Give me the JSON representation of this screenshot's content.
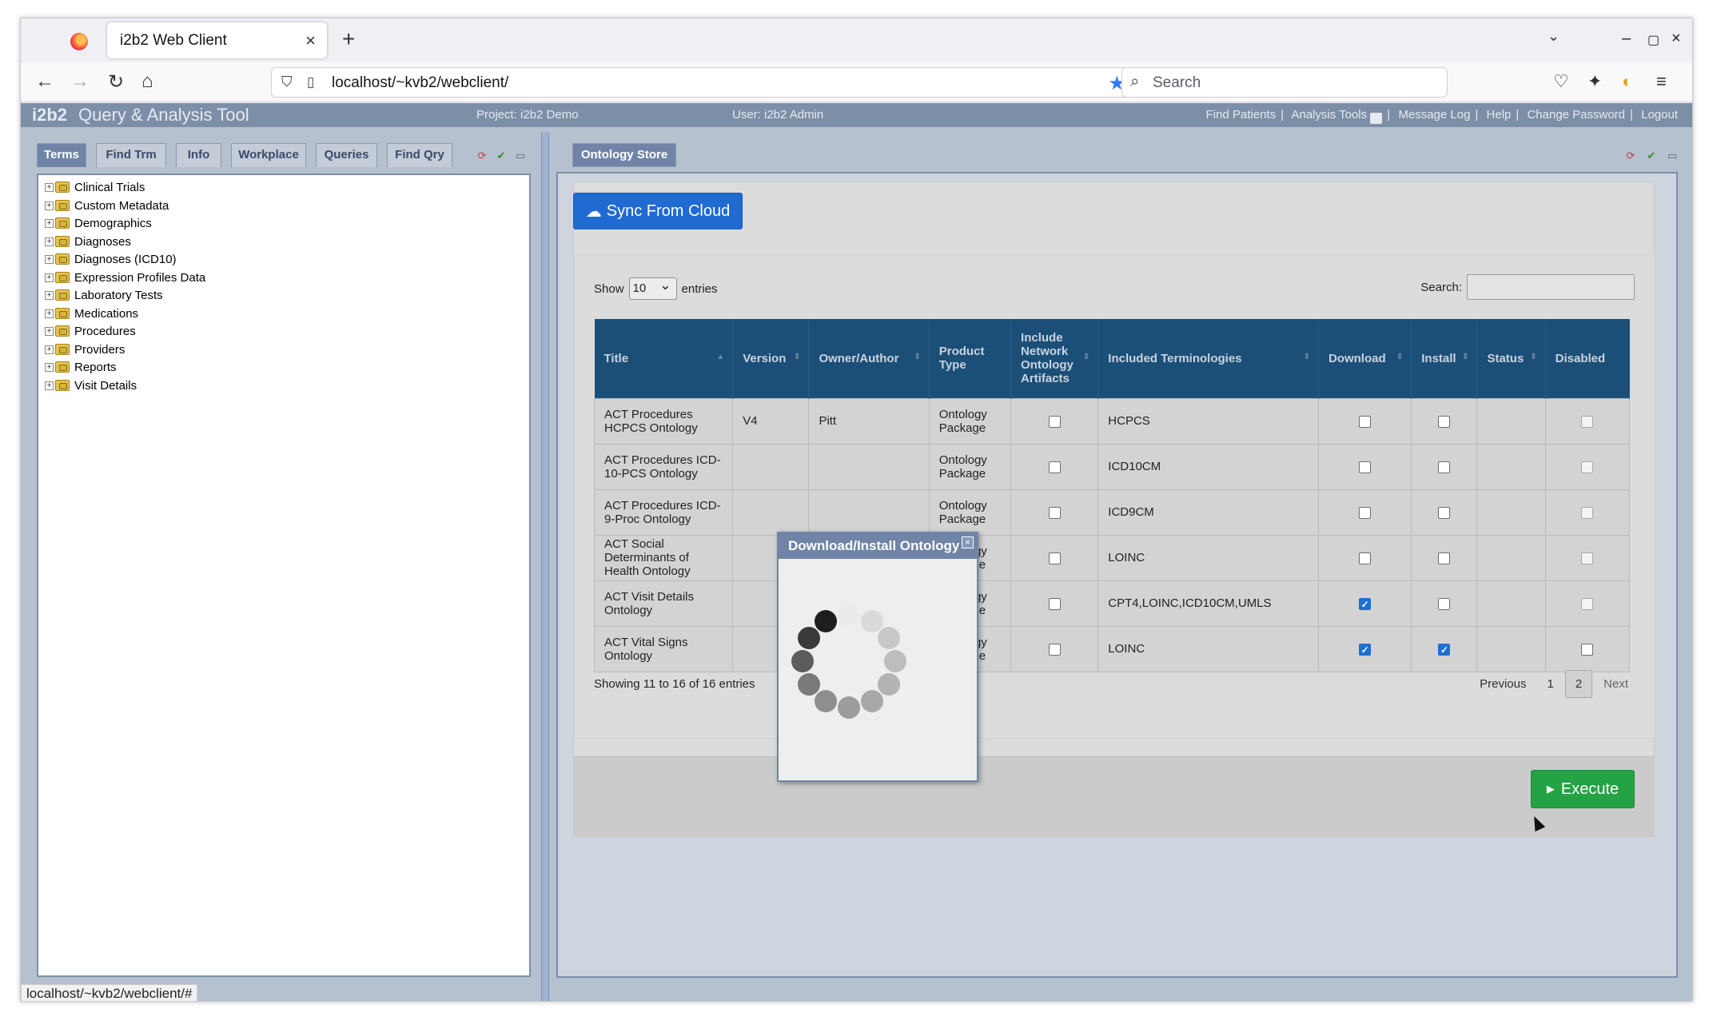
{
  "browser": {
    "tab_title": "i2b2 Web Client",
    "tab_close": "×",
    "new_tab": "+",
    "url": "localhost/~kvb2/webclient/",
    "search_placeholder": "Search",
    "status_url": "localhost/~kvb2/webclient/#"
  },
  "app": {
    "logo": "i2b2",
    "title": "Query & Analysis Tool",
    "project": "Project: i2b2 Demo",
    "user": "User: i2b2 Admin",
    "links": [
      "Find Patients",
      "Analysis Tools",
      "Message Log",
      "Help",
      "Change Password",
      "Logout"
    ]
  },
  "left_panel": {
    "tabs": [
      "Terms",
      "Find Trm",
      "Info",
      "Workplace",
      "Queries",
      "Find Qry"
    ],
    "active_tab": "Terms",
    "tree": [
      "Clinical Trials",
      "Custom Metadata",
      "Demographics",
      "Diagnoses",
      "Diagnoses (ICD10)",
      "Expression Profiles Data",
      "Laboratory Tests",
      "Medications",
      "Procedures",
      "Providers",
      "Reports",
      "Visit Details"
    ]
  },
  "right_panel": {
    "tab": "Ontology Store",
    "sync_button": "Sync From Cloud",
    "length_prefix": "Show",
    "length_value": "10",
    "length_suffix": "entries",
    "search_label": "Search:",
    "columns": [
      "Title",
      "Version",
      "Owner/Author",
      "Product Type",
      "Include Network Ontology Artifacts",
      "Included Terminologies",
      "Download",
      "Install",
      "Status",
      "Disabled"
    ],
    "rows": [
      {
        "title": "ACT Procedures HCPCS Ontology",
        "version": "V4",
        "owner": "Pitt",
        "type": "Ontology Package",
        "include_network": false,
        "terminologies": "HCPCS",
        "download": false,
        "install": false,
        "status": "",
        "disabled": false
      },
      {
        "title": "ACT Procedures ICD-10-PCS Ontology",
        "version": "",
        "owner": "",
        "type": "Ontology Package",
        "include_network": false,
        "terminologies": "ICD10CM",
        "download": false,
        "install": false,
        "status": "",
        "disabled": false
      },
      {
        "title": "ACT Procedures ICD-9-Proc Ontology",
        "version": "",
        "owner": "",
        "type": "Ontology Package",
        "include_network": false,
        "terminologies": "ICD9CM",
        "download": false,
        "install": false,
        "status": "",
        "disabled": false
      },
      {
        "title": "ACT Social Determinants of Health Ontology",
        "version": "",
        "owner": "",
        "type": "Ontology Package",
        "include_network": false,
        "terminologies": "LOINC",
        "download": false,
        "install": false,
        "status": "",
        "disabled": false
      },
      {
        "title": "ACT Visit Details Ontology",
        "version": "",
        "owner": "",
        "type": "Ontology Package",
        "include_network": false,
        "terminologies": "CPT4,LOINC,ICD10CM,UMLS",
        "download": true,
        "install": false,
        "status": "",
        "disabled": false
      },
      {
        "title": "ACT Vital Signs Ontology",
        "version": "",
        "owner": "",
        "type": "Ontology Package",
        "include_network": false,
        "terminologies": "LOINC",
        "download": true,
        "install": true,
        "status": "",
        "disabled": false
      }
    ],
    "info": "Showing 11 to 16 of 16 entries",
    "paginate": {
      "previous": "Previous",
      "pages": [
        "1",
        "2"
      ],
      "current": "2",
      "next": "Next"
    },
    "execute_button": "Execute"
  },
  "modal": {
    "title": "Download/Install Ontology",
    "close": "×"
  },
  "colors": {
    "table_header": "#1b4f78",
    "sync_button": "#1f6bd2",
    "execute_button": "#23a344",
    "app_bar": "#7d8ea7"
  }
}
